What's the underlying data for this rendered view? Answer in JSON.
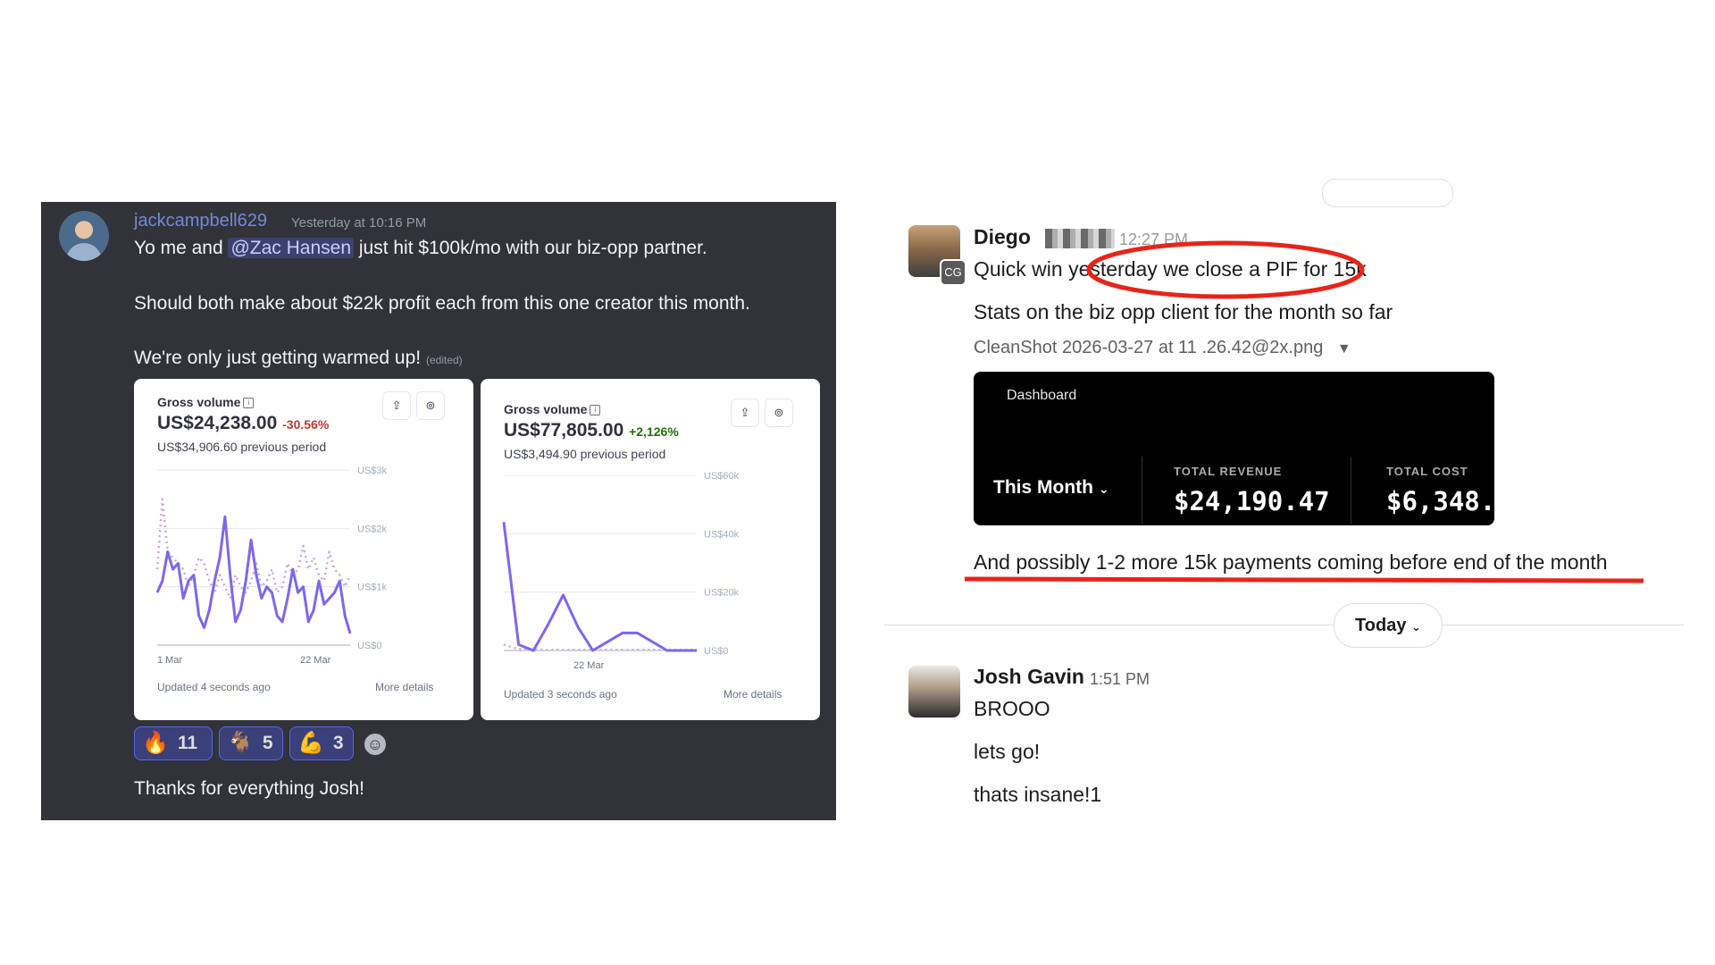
{
  "discord": {
    "username": "jackcampbell629",
    "timestamp": "Yesterday at 10:16 PM",
    "line1_pre": "Yo me and ",
    "mention": "@Zac Hansen",
    "line1_post": " just hit $100k/mo with our biz-opp partner.",
    "line2": "Should both make about $22k profit each from this one creator this month.",
    "line3": "We're only just getting warmed up!",
    "edited": "(edited)",
    "reply": "Thanks for everything Josh!",
    "reactions": [
      {
        "emoji": "🔥",
        "count": "11"
      },
      {
        "emoji": "🐐",
        "count": "5"
      },
      {
        "emoji": "💪",
        "count": "3"
      }
    ],
    "add_reaction_icon": "smiley-icon"
  },
  "chart_data": [
    {
      "type": "line",
      "title": "Gross volume",
      "value": "US$24,238.00",
      "delta": "-30.56%",
      "previous": "US$34,906.60 previous period",
      "y_ticks": [
        "US$3k",
        "US$2k",
        "US$1k",
        "US$0"
      ],
      "x_ticks": [
        "1 Mar",
        "22 Mar"
      ],
      "ylim": [
        0,
        3000
      ],
      "footer_left": "Updated 4 seconds ago",
      "footer_right": "More details",
      "series": [
        {
          "style": "solid",
          "color": "#7b68ee",
          "values": [
            900,
            1100,
            1600,
            1300,
            1400,
            800,
            1100,
            1200,
            500,
            300,
            600,
            1100,
            1500,
            2200,
            1200,
            400,
            600,
            1100,
            1800,
            1200,
            800,
            1000,
            900,
            500,
            400,
            800,
            1300,
            900,
            1000,
            400,
            600,
            1100,
            700,
            800,
            900,
            1100,
            500,
            200
          ]
        },
        {
          "style": "dotted",
          "color": "#c4a9d8",
          "values": [
            1300,
            2500,
            1600,
            1500,
            1400,
            1300,
            1000,
            1200,
            1500,
            1400,
            1100,
            900,
            1200,
            1000,
            800,
            1200,
            1000,
            900,
            1100,
            1400,
            1000,
            1100,
            1300,
            900,
            1000,
            1400,
            1200,
            1300,
            1700,
            1300,
            1500,
            1200,
            1100,
            1600,
            1300,
            1200,
            1000,
            1200
          ]
        }
      ]
    },
    {
      "type": "line",
      "title": "Gross volume",
      "value": "US$77,805.00",
      "delta": "+2,126%",
      "previous": "US$3,494.90 previous period",
      "y_ticks": [
        "US$60k",
        "US$40k",
        "US$20k",
        "US$0"
      ],
      "x_ticks": [
        "22 Mar"
      ],
      "ylim": [
        0,
        60000
      ],
      "footer_left": "Updated 3 seconds ago",
      "footer_right": "More details",
      "series": [
        {
          "style": "solid",
          "color": "#7b68ee",
          "values": [
            44000,
            2000,
            0,
            9000,
            19000,
            8000,
            0,
            3000,
            6000,
            6000,
            3000,
            0,
            0,
            0
          ]
        },
        {
          "style": "dotted",
          "color": "#c4a9d8",
          "values": [
            2000,
            500,
            300,
            200,
            200,
            200,
            200,
            200,
            200,
            200,
            200,
            200,
            200,
            200
          ]
        }
      ]
    }
  ],
  "slack": {
    "msg1": {
      "name": "Diego",
      "time": "12:27 PM",
      "badge": "CG",
      "text1": "Quick win yesterday we close a PIF for 15k",
      "text2": "Stats on the biz opp client for the month so far",
      "file": "CleanShot 2026-03-27 at 11 .26.42@2x.png",
      "text3": "And possibly 1-2 more 15k payments coming before end of the month"
    },
    "dashboard": {
      "title": "Dashboard",
      "period": "This Month",
      "revenue_label": "TOTAL REVENUE",
      "revenue_value": "$24,190.47",
      "cost_label": "TOTAL COST",
      "cost_value": "$6,348."
    },
    "today_label": "Today",
    "msg2": {
      "name": "Josh Gavin",
      "time": "1:51 PM",
      "lines": [
        "BROOO",
        "lets go!",
        "thats insane!1"
      ]
    },
    "annotation_color": "#e8241a"
  }
}
